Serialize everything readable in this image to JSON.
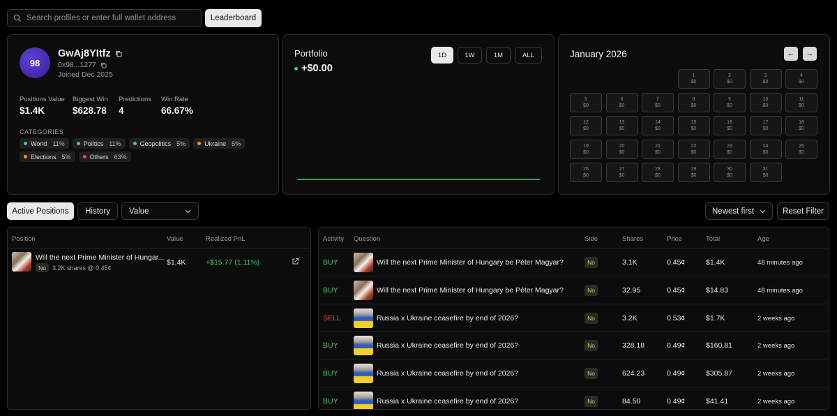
{
  "search": {
    "placeholder": "Search profiles or enter full wallet address",
    "value": ""
  },
  "leaderboard_label": "Leaderboard",
  "profile": {
    "avatar_text": "98",
    "username": "GwAj8YItfz",
    "address": "0x98...1277",
    "joined": "Joined Dec 2025",
    "stats": [
      {
        "label": "Positions Value",
        "value": "$1.4K"
      },
      {
        "label": "Biggest Win",
        "value": "$628.78"
      },
      {
        "label": "Predictions",
        "value": "4"
      },
      {
        "label": "Win Rate",
        "value": "66.67%"
      }
    ],
    "categories_title": "CATEGORIES",
    "categories": [
      {
        "name": "World",
        "pct": "11%",
        "color": "#4ecb71"
      },
      {
        "name": "Politics",
        "pct": "11%",
        "color": "#4ecb71"
      },
      {
        "name": "Geopolitics",
        "pct": "5%",
        "color": "#4ecb71"
      },
      {
        "name": "Ukraine",
        "pct": "5%",
        "color": "#f0922b"
      },
      {
        "name": "Elections",
        "pct": "5%",
        "color": "#f0922b"
      },
      {
        "name": "Others",
        "pct": "63%",
        "color": "#e5484d"
      }
    ]
  },
  "portfolio": {
    "title": "Portfolio",
    "value": "+$0.00",
    "ranges": [
      "1D",
      "1W",
      "1M",
      "ALL"
    ],
    "selected_range": "1D",
    "line_color": "#4ecb71"
  },
  "calendar": {
    "title": "January 2026",
    "prev_icon": "arrow-left-icon",
    "next_icon": "arrow-right-icon",
    "days": [
      {
        "day": "1",
        "amount": "$0"
      },
      {
        "day": "2",
        "amount": "$0"
      },
      {
        "day": "3",
        "amount": "$0"
      },
      {
        "day": "4",
        "amount": "$0"
      },
      {
        "day": "5",
        "amount": "$0"
      },
      {
        "day": "6",
        "amount": "$0"
      },
      {
        "day": "7",
        "amount": "$0"
      },
      {
        "day": "8",
        "amount": "$0"
      },
      {
        "day": "9",
        "amount": "$0"
      },
      {
        "day": "10",
        "amount": "$0"
      },
      {
        "day": "11",
        "amount": "$0"
      },
      {
        "day": "12",
        "amount": "$0"
      },
      {
        "day": "13",
        "amount": "$0"
      },
      {
        "day": "14",
        "amount": "$0"
      },
      {
        "day": "15",
        "amount": "$0"
      },
      {
        "day": "16",
        "amount": "$0"
      },
      {
        "day": "17",
        "amount": "$0"
      },
      {
        "day": "18",
        "amount": "$0"
      },
      {
        "day": "19",
        "amount": "$0"
      },
      {
        "day": "20",
        "amount": "$0"
      },
      {
        "day": "21",
        "amount": "$0"
      },
      {
        "day": "22",
        "amount": "$0"
      },
      {
        "day": "23",
        "amount": "$0"
      },
      {
        "day": "24",
        "amount": "$0"
      },
      {
        "day": "25",
        "amount": "$0"
      },
      {
        "day": "26",
        "amount": "$0"
      },
      {
        "day": "27",
        "amount": "$0"
      },
      {
        "day": "28",
        "amount": "$0"
      },
      {
        "day": "29",
        "amount": "$0"
      },
      {
        "day": "30",
        "amount": "$0"
      },
      {
        "day": "31",
        "amount": "$0"
      }
    ]
  },
  "tabs": {
    "active": "Active Positions",
    "history": "History",
    "sort_select": "Value"
  },
  "filters": {
    "order_select": "Newest first",
    "reset": "Reset Filter"
  },
  "positions": {
    "columns": [
      "Position",
      "Value",
      "Realized PnL"
    ],
    "rows": [
      {
        "title": "Will the next Prime Minister of Hungar...",
        "side": "No",
        "detail": "3.2K shares @ 0.45¢",
        "value": "$1.4K",
        "pnl": "+$15.77 (1.11%)"
      }
    ]
  },
  "activity": {
    "columns": [
      "Activity",
      "Question",
      "Side",
      "Shares",
      "Price",
      "Total",
      "Age"
    ],
    "rows": [
      {
        "type": "BUY",
        "thumb": "pm",
        "question": "Will the next Prime Minister of Hungary be Péter Magyar?",
        "side": "No",
        "shares": "3.1K",
        "price": "0.45¢",
        "total": "$1.4K",
        "age": "48 minutes ago"
      },
      {
        "type": "BUY",
        "thumb": "pm",
        "question": "Will the next Prime Minister of Hungary be Péter Magyar?",
        "side": "No",
        "shares": "32.95",
        "price": "0.45¢",
        "total": "$14.83",
        "age": "48 minutes ago"
      },
      {
        "type": "SELL",
        "thumb": "ua",
        "question": "Russia x Ukraine ceasefire by end of 2026?",
        "side": "No",
        "shares": "3.2K",
        "price": "0.53¢",
        "total": "$1.7K",
        "age": "2 weeks ago"
      },
      {
        "type": "BUY",
        "thumb": "ua",
        "question": "Russia x Ukraine ceasefire by end of 2026?",
        "side": "No",
        "shares": "328.18",
        "price": "0.49¢",
        "total": "$160.81",
        "age": "2 weeks ago"
      },
      {
        "type": "BUY",
        "thumb": "ua",
        "question": "Russia x Ukraine ceasefire by end of 2026?",
        "side": "No",
        "shares": "624.23",
        "price": "0.49¢",
        "total": "$305.87",
        "age": "2 weeks ago"
      },
      {
        "type": "BUY",
        "thumb": "ua",
        "question": "Russia x Ukraine ceasefire by end of 2026?",
        "side": "No",
        "shares": "84.50",
        "price": "0.49¢",
        "total": "$41.41",
        "age": "2 weeks ago"
      }
    ]
  }
}
